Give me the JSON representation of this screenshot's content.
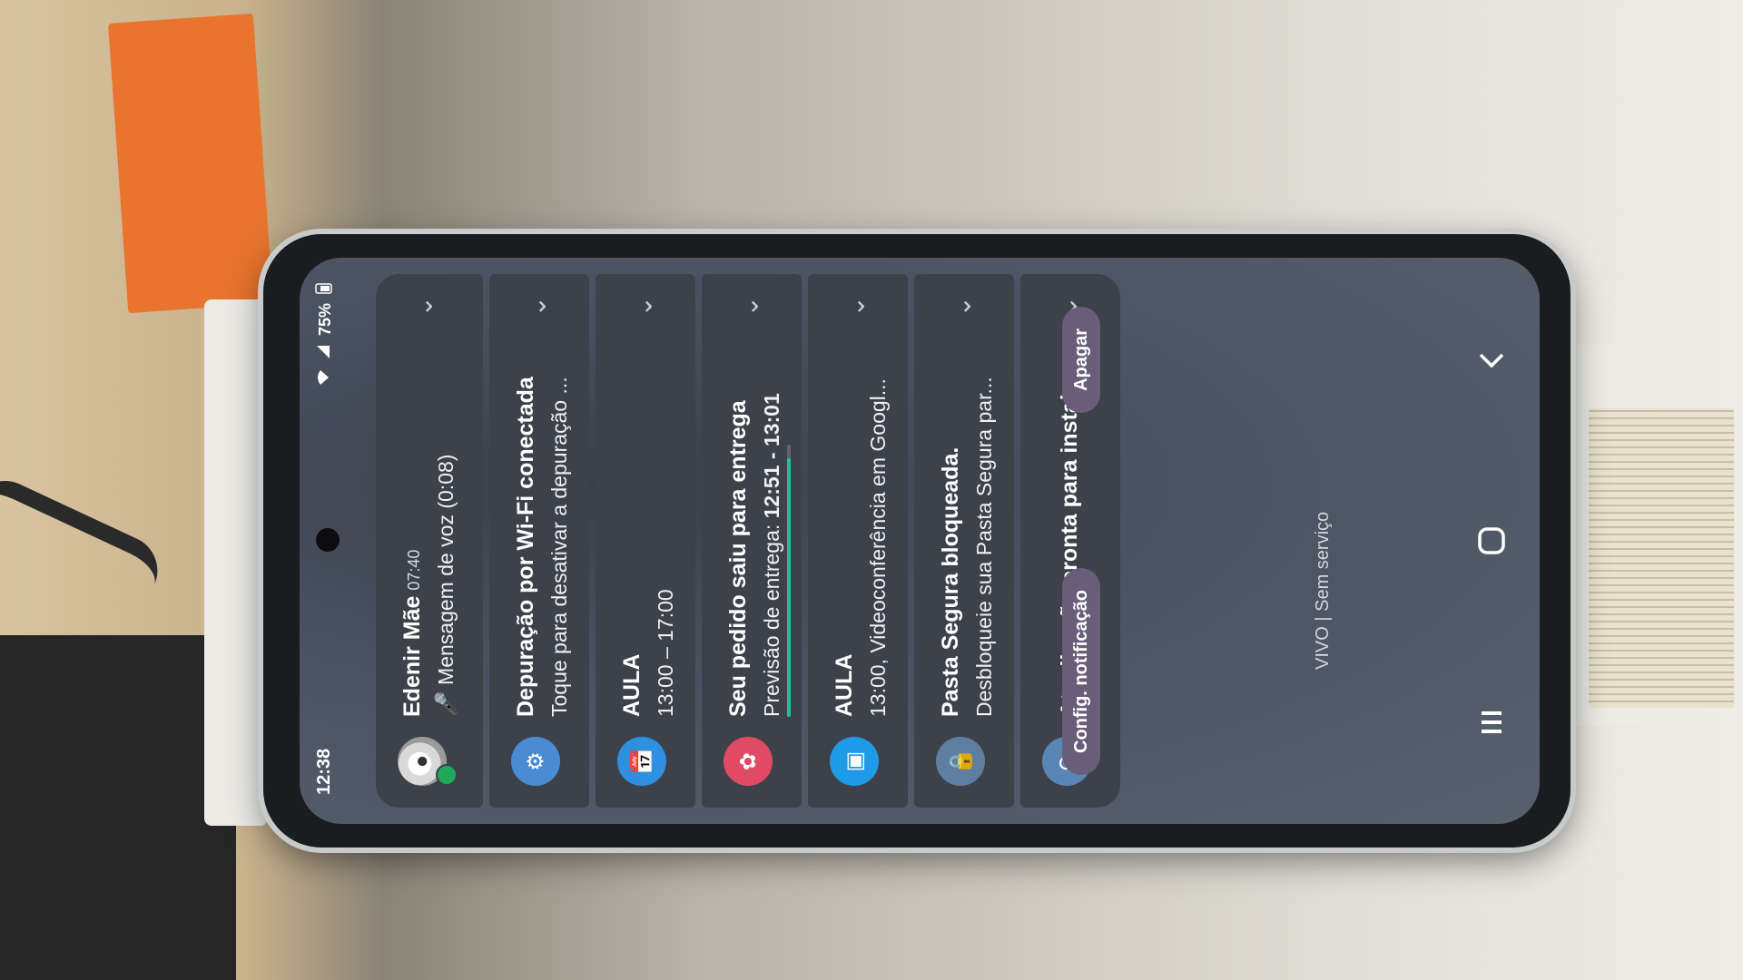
{
  "status_bar": {
    "time": "12:38",
    "battery": "75%"
  },
  "notifications": [
    {
      "icon": "avatar-icon",
      "title": "Edenir Mãe",
      "time": "07:40",
      "text": "Mensagem de voz (0:08)"
    },
    {
      "icon": "gear-icon",
      "title": "Depuração por Wi-Fi conectada",
      "text": "Toque para desativar a depuração ..."
    },
    {
      "icon": "calendar-icon",
      "title": "AULA",
      "text": "13:00 – 17:00"
    },
    {
      "icon": "delivery-icon",
      "title": "Seu pedido saiu para entrega",
      "text_prefix": "Previsão de entrega: ",
      "text_bold": "12:51 - 13:01",
      "progress": 0.95
    },
    {
      "icon": "meet-icon",
      "title": "AULA",
      "text": "13:00, Videoconferência em Googl..."
    },
    {
      "icon": "secure-folder-icon",
      "title": "Pasta Segura bloqueada.",
      "text": "Desbloqueie sua Pasta Segura par..."
    },
    {
      "icon": "update-icon",
      "title": "Atualização pronta para instalaç..."
    }
  ],
  "actions": {
    "config": "Config. notificação",
    "clear": "Apagar"
  },
  "carrier": "VIVO | Sem serviço",
  "colors": {
    "card": "#3c414a",
    "gear": "#4a8bd6",
    "calendar": "#2f8fe0",
    "delivery": "#e04a62",
    "meet": "#1e9be6",
    "folder": "#5f7fa0",
    "update": "#5a86b5",
    "progress": "#19c29a"
  }
}
